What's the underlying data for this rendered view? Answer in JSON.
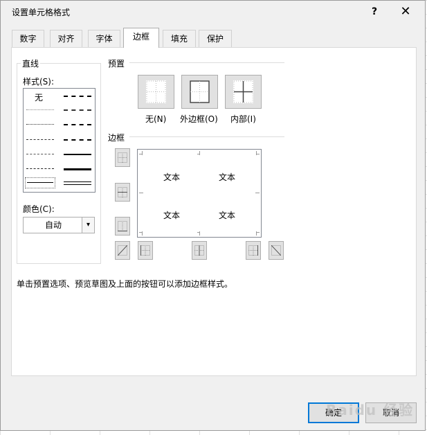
{
  "window": {
    "title": "设置单元格格式",
    "help_label": "?",
    "close_label": "✕"
  },
  "tabs": [
    {
      "label": "数字",
      "active": false
    },
    {
      "label": "对齐",
      "active": false
    },
    {
      "label": "字体",
      "active": false
    },
    {
      "label": "边框",
      "active": true
    },
    {
      "label": "填充",
      "active": false
    },
    {
      "label": "保护",
      "active": false
    }
  ],
  "line": {
    "group_label": "直线",
    "style_label": "样式(S):",
    "style_none": "无",
    "color_label": "颜色(C):",
    "color_value": "自动"
  },
  "presets": {
    "section_label": "预置",
    "none_label": "无(N)",
    "outline_label": "外边框(O)",
    "inside_label": "内部(I)"
  },
  "border": {
    "section_label": "边框",
    "preview_texts": [
      "文本",
      "文本",
      "文本",
      "文本"
    ]
  },
  "hint": "单击预置选项、预览草图及上面的按钮可以添加边框样式。",
  "buttons": {
    "ok_label": "确定",
    "cancel_label": "取消"
  },
  "watermark": "Baidu 经验"
}
